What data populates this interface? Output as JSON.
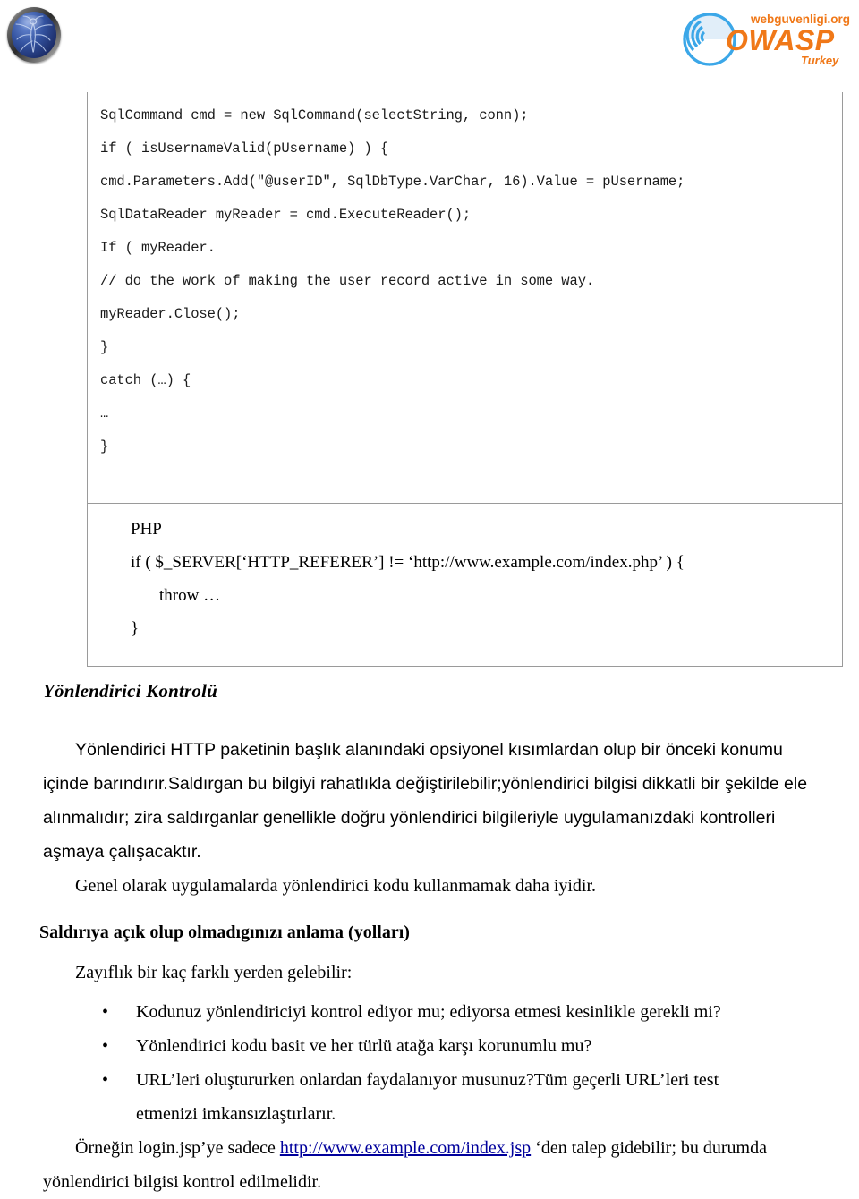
{
  "header": {
    "owasp_mark_name": "owasp-globe-logo",
    "brand": {
      "top_text": "webguvenligi.org",
      "main_text": "OWASP",
      "sub_text": "Turkey",
      "accent_color": "#F07818",
      "blue_color": "#2E9BE0"
    }
  },
  "csharp_block": {
    "lines": [
      "SqlCommand cmd = new SqlCommand(selectString, conn);",
      "",
      "if ( isUsernameValid(pUsername) ) {",
      "",
      "cmd.Parameters.Add(\"@userID\", SqlDbType.VarChar, 16).Value = pUsername;",
      "",
      "",
      "SqlDataReader myReader = cmd.ExecuteReader();",
      "",
      "If ( myReader.",
      "",
      "// do the work of making the user record active in some way.",
      "",
      "myReader.Close();",
      "",
      "}",
      "",
      "catch (…) {",
      "",
      "…",
      "",
      "}"
    ]
  },
  "php_block": {
    "label": "PHP",
    "line_if": "if ( $_SERVER[‘HTTP_REFERER’] != ‘http://www.example.com/index.php’ ) {",
    "line_throw": "throw …",
    "line_close": "}"
  },
  "content": {
    "section_title": "Yönlendirici Kontrolü",
    "paragraph_sans": "Yönlendirici HTTP paketinin başlık alanındaki opsiyonel kısımlardan olup bir önceki konumu içinde barındırır.Saldırgan bu bilgiyi rahatlıkla değiştirilebilir;yönlendirici bilgisi dikkatli bir şekilde ele alınmalıdır; zira saldırganlar genellikle doğru yönlendirici bilgileriyle uygulamanızdaki kontrolleri aşmaya çalışacaktır.",
    "paragraph_serif": "Genel olarak uygulamalarda yönlendirici kodu kullanmamak daha iyidir.",
    "sub_title": "Saldırıya açık olup olmadıgınızı anlama (yolları)",
    "intro": "Zayıflık bir kaç farklı yerden gelebilir:",
    "bullet_marker": "•",
    "bullets": [
      "Kodunuz yönlendiriciyi kontrol ediyor mu; ediyorsa etmesi kesinlikle gerekli mi?",
      "Yönlendirici kodu basit ve her türlü atağa karşı korunumlu mu?",
      "URL’leri oluştururken onlardan faydalanıyor musunuz?Tüm geçerli URL’leri test",
      "etmenizi imkansızlaştırlarır."
    ],
    "closing": {
      "before_link": "Örneğin login.jsp’ye sadece ",
      "link_text": "http://www.example.com/index.jsp",
      "after_link": " ‘den talep gidebilir; bu durumda yönlendirici bilgisi kontrol edilmelidir.",
      "link_color": "#00009c"
    }
  }
}
